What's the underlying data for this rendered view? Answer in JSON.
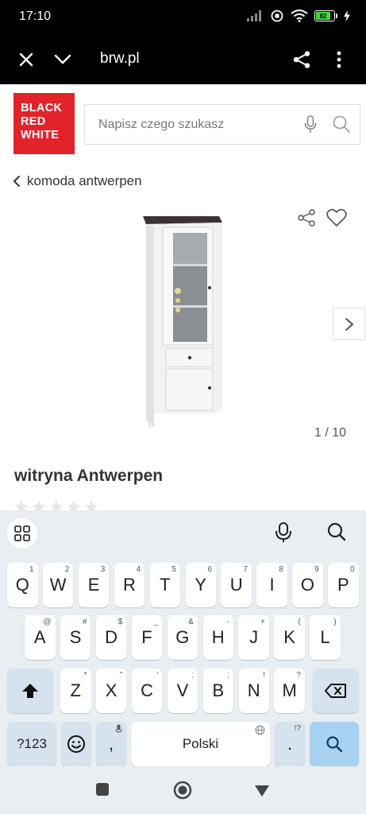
{
  "status_bar": {
    "time": "17:10",
    "battery_level": "82"
  },
  "browser": {
    "url": "brw.pl"
  },
  "logo": {
    "line1": "BLACK",
    "line2": "RED",
    "line3": "WHITE"
  },
  "search": {
    "placeholder": "Napisz czego szukasz"
  },
  "breadcrumb": {
    "label": "komoda antwerpen"
  },
  "gallery": {
    "counter": "1 / 10"
  },
  "product": {
    "title": "witryna Antwerpen",
    "rating_stars": 5
  },
  "keyboard": {
    "row1": [
      {
        "key": "Q",
        "hint": "1"
      },
      {
        "key": "W",
        "hint": "2"
      },
      {
        "key": "E",
        "hint": "3"
      },
      {
        "key": "R",
        "hint": "4"
      },
      {
        "key": "T",
        "hint": "5"
      },
      {
        "key": "Y",
        "hint": "6"
      },
      {
        "key": "U",
        "hint": "7"
      },
      {
        "key": "I",
        "hint": "8"
      },
      {
        "key": "O",
        "hint": "9"
      },
      {
        "key": "P",
        "hint": "0"
      }
    ],
    "row2": [
      {
        "key": "A",
        "hint": "@"
      },
      {
        "key": "S",
        "hint": "#"
      },
      {
        "key": "D",
        "hint": "$"
      },
      {
        "key": "F",
        "hint": "_"
      },
      {
        "key": "G",
        "hint": "&"
      },
      {
        "key": "H",
        "hint": "-"
      },
      {
        "key": "J",
        "hint": "+"
      },
      {
        "key": "K",
        "hint": "("
      },
      {
        "key": "L",
        "hint": ")"
      }
    ],
    "row3": [
      {
        "key": "Z",
        "hint": "*"
      },
      {
        "key": "X",
        "hint": "\""
      },
      {
        "key": "C",
        "hint": "'"
      },
      {
        "key": "V",
        "hint": ":"
      },
      {
        "key": "B",
        "hint": ";"
      },
      {
        "key": "N",
        "hint": "!"
      },
      {
        "key": "M",
        "hint": "?"
      }
    ],
    "symbols_label": "?123",
    "comma": ",",
    "space_label": "Polski",
    "period": ".",
    "period_hint": "!?"
  }
}
